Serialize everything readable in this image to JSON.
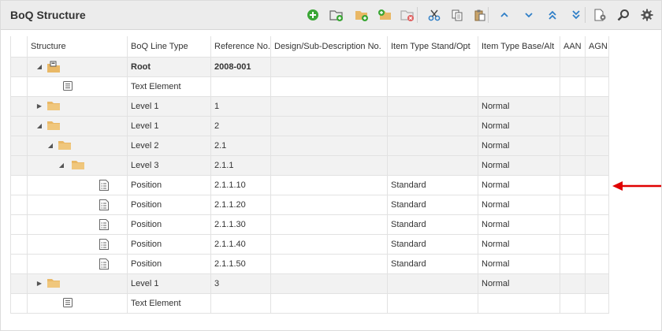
{
  "panel": {
    "title": "BoQ Structure"
  },
  "toolbar": {
    "buttons": [
      {
        "name": "add-button",
        "icon": "plus-circle-icon"
      },
      {
        "name": "add-subdivision-button",
        "icon": "folder-add-icon"
      },
      {
        "name": "new-level-button",
        "icon": "folder-plus-icon"
      },
      {
        "name": "new-sublevel-button",
        "icon": "folder-plus-alt-icon"
      },
      {
        "name": "delete-folder-button",
        "icon": "folder-delete-icon"
      },
      {
        "name": "cut-button",
        "icon": "scissors-icon"
      },
      {
        "name": "copy-button",
        "icon": "copy-icon"
      },
      {
        "name": "paste-button",
        "icon": "paste-icon"
      },
      {
        "name": "move-up-button",
        "icon": "chevron-up-icon"
      },
      {
        "name": "move-down-button",
        "icon": "chevron-down-icon"
      },
      {
        "name": "move-top-button",
        "icon": "double-chevron-up-icon"
      },
      {
        "name": "move-bottom-button",
        "icon": "double-chevron-down-icon"
      },
      {
        "name": "document-settings-button",
        "icon": "document-gear-icon"
      },
      {
        "name": "search-button",
        "icon": "search-icon"
      },
      {
        "name": "settings-button",
        "icon": "gear-icon"
      }
    ]
  },
  "grid": {
    "columns": [
      "Structure",
      "BoQ Line Type",
      "Reference No.",
      "Design/Sub-Description No.",
      "Item Type Stand/Opt",
      "Item Type Base/Alt",
      "AAN",
      "AGN"
    ],
    "rows": [
      {
        "level": 1,
        "caret": "down",
        "icon": "root",
        "type": "Root",
        "ref": "2008-001",
        "design": "",
        "stand": "",
        "base": "",
        "aan": "",
        "agn": "",
        "bold": true,
        "alt": true
      },
      {
        "level": 2,
        "caret": "",
        "icon": "text",
        "type": "Text Element",
        "ref": "",
        "design": "",
        "stand": "",
        "base": "",
        "aan": "",
        "agn": "",
        "bold": false,
        "alt": false
      },
      {
        "level": 1,
        "caret": "right",
        "icon": "folder",
        "type": "Level 1",
        "ref": "1",
        "design": "",
        "stand": "",
        "base": "Normal",
        "aan": "",
        "agn": "",
        "bold": false,
        "alt": true
      },
      {
        "level": 1,
        "caret": "down",
        "icon": "folder",
        "type": "Level 1",
        "ref": "2",
        "design": "",
        "stand": "",
        "base": "Normal",
        "aan": "",
        "agn": "",
        "bold": false,
        "alt": true
      },
      {
        "level": 2,
        "caret": "down",
        "icon": "folder",
        "type": "Level 2",
        "ref": "2.1",
        "design": "",
        "stand": "",
        "base": "Normal",
        "aan": "",
        "agn": "",
        "bold": false,
        "alt": true
      },
      {
        "level": 3,
        "caret": "down",
        "icon": "folder",
        "type": "Level 3",
        "ref": "2.1.1",
        "design": "",
        "stand": "",
        "base": "Normal",
        "aan": "",
        "agn": "",
        "bold": false,
        "alt": true
      },
      {
        "level": 4,
        "caret": "",
        "icon": "position",
        "type": "Position",
        "ref": "2.1.1.10",
        "design": "",
        "stand": "Standard",
        "base": "Normal",
        "aan": "",
        "agn": "",
        "bold": false,
        "alt": false
      },
      {
        "level": 4,
        "caret": "",
        "icon": "position",
        "type": "Position",
        "ref": "2.1.1.20",
        "design": "",
        "stand": "Standard",
        "base": "Normal",
        "aan": "",
        "agn": "",
        "bold": false,
        "alt": false
      },
      {
        "level": 4,
        "caret": "",
        "icon": "position",
        "type": "Position",
        "ref": "2.1.1.30",
        "design": "",
        "stand": "Standard",
        "base": "Normal",
        "aan": "",
        "agn": "",
        "bold": false,
        "alt": false
      },
      {
        "level": 4,
        "caret": "",
        "icon": "position",
        "type": "Position",
        "ref": "2.1.1.40",
        "design": "",
        "stand": "Standard",
        "base": "Normal",
        "aan": "",
        "agn": "",
        "bold": false,
        "alt": false
      },
      {
        "level": 4,
        "caret": "",
        "icon": "position",
        "type": "Position",
        "ref": "2.1.1.50",
        "design": "",
        "stand": "Standard",
        "base": "Normal",
        "aan": "",
        "agn": "",
        "bold": false,
        "alt": false
      },
      {
        "level": 1,
        "caret": "right",
        "icon": "folder",
        "type": "Level 1",
        "ref": "3",
        "design": "",
        "stand": "",
        "base": "Normal",
        "aan": "",
        "agn": "",
        "bold": false,
        "alt": true
      },
      {
        "level": 2,
        "caret": "",
        "icon": "text",
        "type": "Text Element",
        "ref": "",
        "design": "",
        "stand": "",
        "base": "",
        "aan": "",
        "agn": "",
        "bold": false,
        "alt": false
      }
    ]
  },
  "annotation": {
    "icon": "red-arrow-left-icon",
    "color": "#e00000"
  },
  "colors": {
    "folder": "#e9b866",
    "toolbar_green": "#3aa635",
    "toolbar_blue": "#2f7fc7",
    "toolbar_gray": "#555555"
  }
}
